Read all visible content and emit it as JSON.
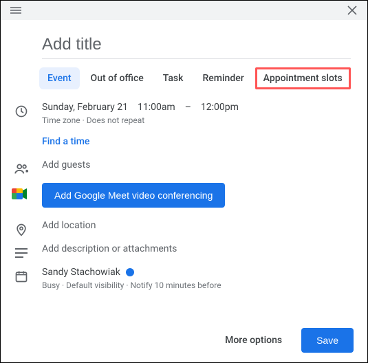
{
  "title": {
    "placeholder": "Add title"
  },
  "tabs": {
    "event": "Event",
    "out_of_office": "Out of office",
    "task": "Task",
    "reminder": "Reminder",
    "appointment_slots": "Appointment slots"
  },
  "datetime": {
    "date": "Sunday, February 21",
    "start": "11:00am",
    "sep": "–",
    "end": "12:00pm",
    "sub": "Time zone · Does not repeat",
    "find_a_time": "Find a time"
  },
  "guests": {
    "placeholder": "Add guests"
  },
  "meet": {
    "button": "Add Google Meet video conferencing"
  },
  "location": {
    "placeholder": "Add location"
  },
  "description": {
    "placeholder": "Add description or attachments"
  },
  "calendar": {
    "owner": "Sandy Stachowiak",
    "sub": "Busy · Default visibility · Notify 10 minutes before",
    "color": "#1a73e8"
  },
  "footer": {
    "more_options": "More options",
    "save": "Save"
  }
}
